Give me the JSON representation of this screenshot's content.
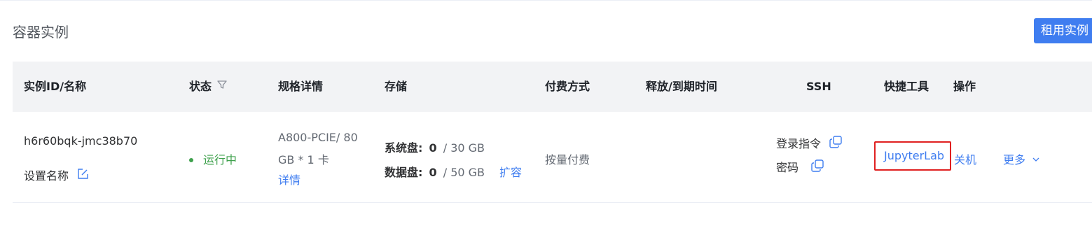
{
  "page": {
    "title": "容器实例",
    "rent_button": "租用实例"
  },
  "table": {
    "headers": {
      "instance": "实例ID/名称",
      "status": "状态",
      "spec": "规格详情",
      "storage": "存储",
      "payment": "付费方式",
      "release": "释放/到期时间",
      "ssh": "SSH",
      "quick_tools": "快捷工具",
      "actions": "操作"
    },
    "row": {
      "instance_id": "h6r60bqk-jmc38b70",
      "set_name": "设置名称",
      "status": "运行中",
      "spec_line1": "A800-PCIE/ 80",
      "spec_line2": "GB * 1 卡",
      "spec_detail": "详情",
      "system_disk_label": "系统盘:",
      "system_disk_used": "0",
      "system_disk_total": "/ 30 GB",
      "data_disk_label": "数据盘:",
      "data_disk_used": "0",
      "data_disk_total": "/ 50 GB",
      "expand": "扩容",
      "payment": "按量付费",
      "release": "",
      "ssh_login": "登录指令",
      "ssh_password": "密码",
      "quick_tool": "JupyterLab",
      "shutdown": "关机",
      "more": "更多"
    }
  },
  "icons": {
    "filter": "filter-icon",
    "edit": "edit-icon",
    "copy": "copy-icon",
    "chevron": "chevron-down-icon"
  },
  "colors": {
    "primary": "#3f7df0",
    "running": "#3fa14d",
    "highlight_border": "#e02020",
    "header_bg": "#f2f3f5"
  }
}
